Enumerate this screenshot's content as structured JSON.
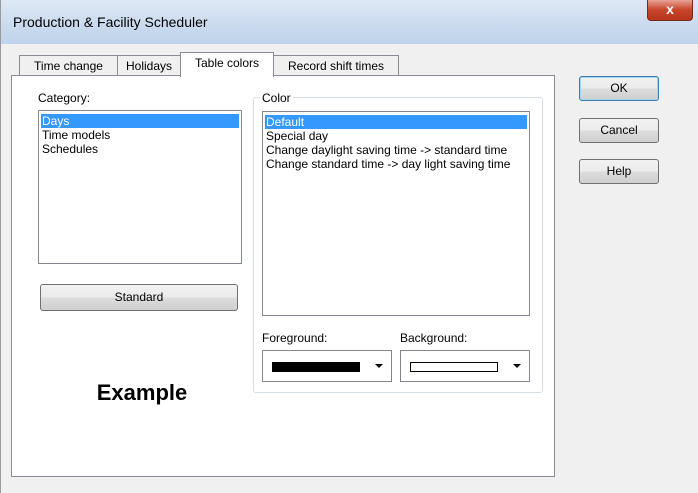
{
  "window": {
    "title": "Production & Facility Scheduler",
    "close_glyph": "x"
  },
  "tabs": [
    {
      "label": "Time change"
    },
    {
      "label": "Holidays"
    },
    {
      "label": "Table colors"
    },
    {
      "label": "Record shift times"
    }
  ],
  "active_tab": "Table colors",
  "category": {
    "label": "Category:",
    "items": [
      "Days",
      "Time models",
      "Schedules"
    ],
    "selected": "Days"
  },
  "standard_button": "Standard",
  "example_text": "Example",
  "color": {
    "group_label": "Color",
    "items": [
      "Default",
      "Special day",
      "Change daylight saving time -> standard time",
      "Change standard time -> day light saving time"
    ],
    "selected": "Default"
  },
  "foreground": {
    "label": "Foreground:",
    "value_color": "#000000"
  },
  "background": {
    "label": "Background:",
    "value_color": "#ffffff"
  },
  "buttons": {
    "ok": "OK",
    "cancel": "Cancel",
    "help": "Help"
  },
  "colors": {
    "selection": "#3399ff"
  }
}
